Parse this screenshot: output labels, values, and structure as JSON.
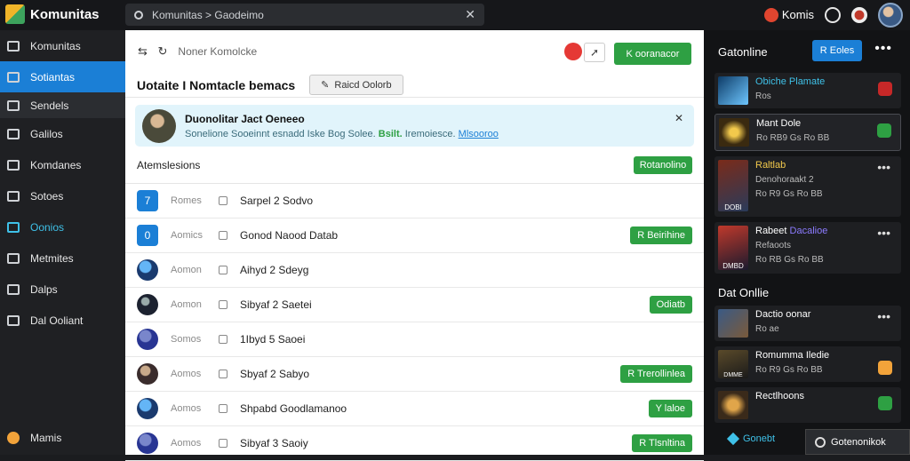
{
  "app": {
    "name": "Komunitas"
  },
  "search": {
    "text": "Komunitas > Gaodeimo"
  },
  "topbar": {
    "user_label": "Komis"
  },
  "sidebar": {
    "items": [
      {
        "label": "Komunitas"
      },
      {
        "label": "Sotiantas"
      },
      {
        "label": "Sendels"
      },
      {
        "label": "Galilos"
      },
      {
        "label": "Komdanes"
      },
      {
        "label": "Sotoes"
      },
      {
        "label": "Oonios"
      },
      {
        "label": "Metmites"
      },
      {
        "label": "Dalps"
      },
      {
        "label": "Dal Ooliant"
      }
    ],
    "bottom_label": "Mamis"
  },
  "main": {
    "breadcrumb": "Noner Komolcke",
    "join_label": "K ooranacor",
    "title": "Uotaite I Nomtacle bemacs",
    "gray_button_label": "Raicd Oolorb",
    "banner": {
      "title": "Duonolitar Jact Oeneeo",
      "text_prefix": "Sonelione Sooeinnt",
      "text_mid": "esnadd",
      "text_mid2": "Iske Bog Solee.",
      "green_text": "Bsilt.",
      "teal_text": "Iremoiesce.",
      "link_text": "Mlsooroo"
    },
    "section_title": "Atemslesions",
    "section_button": "Rotanolino",
    "rows": [
      {
        "icon": "7",
        "muted": "Romes",
        "name": "Sarpel 2 Sodvo",
        "button": ""
      },
      {
        "icon": "0",
        "muted": "Aomics",
        "name": "Gonod Naood Datab",
        "button": "R Beirihine"
      },
      {
        "icon": "",
        "muted": "Aomon",
        "name": "Aihyd 2 Sdeyg",
        "button": ""
      },
      {
        "icon": "",
        "muted": "Aomon",
        "name": "Sibyaf 2 Saetei",
        "button": "Odiatb"
      },
      {
        "icon": "",
        "muted": "Somos",
        "name": "1Ibyd 5 Saoei",
        "button": ""
      },
      {
        "icon": "",
        "muted": "Aomos",
        "name": "Sbyaf 2 Sabyo",
        "button": "R Trerollinlea"
      },
      {
        "icon": "",
        "muted": "Aomos",
        "name": "Shpabd Goodlamanoo",
        "button": "Y laloe"
      },
      {
        "icon": "",
        "muted": "Aomos",
        "name": "Sibyaf 3 Saoiy",
        "button": "R Tlsnltina"
      }
    ]
  },
  "right": {
    "header": "Gatonline",
    "header_button": "R Eoles",
    "cards_top": [
      {
        "title": "Obiche Plamate",
        "sub": "Ros",
        "badge": "#c62828",
        "teal": true
      },
      {
        "title": "Mant Dole",
        "sub": "Ro RB9 Gs Ro BB",
        "badge": "#2ea043",
        "teal": false
      }
    ],
    "cards_mid": [
      {
        "title": "Raltlab",
        "sub": "Denohoraakt 2",
        "sub2": "Ro R9 Gs Ro BB",
        "thumb_label": "DOBI"
      },
      {
        "title": "Rabeet",
        "title2": "Dacalioe",
        "sub": "Refaoots",
        "sub2": "Ro RB Gs Ro BB",
        "thumb_label": "DMBD"
      }
    ],
    "sub_header": "Dat Onllie",
    "cards_bottom": [
      {
        "title": "Dactio oonar",
        "sub": "Ro ae",
        "badge": ""
      },
      {
        "title": "Romumma Iledie",
        "sub": "Ro R9 Gs Ro BB",
        "thumb_label": "DMME",
        "badge": "#f2a33a"
      },
      {
        "title": "Rectlhoons",
        "sub": "",
        "badge": "#2ea043"
      }
    ],
    "toast": "Gotenonikok",
    "foot_chip": "Gonebt"
  }
}
